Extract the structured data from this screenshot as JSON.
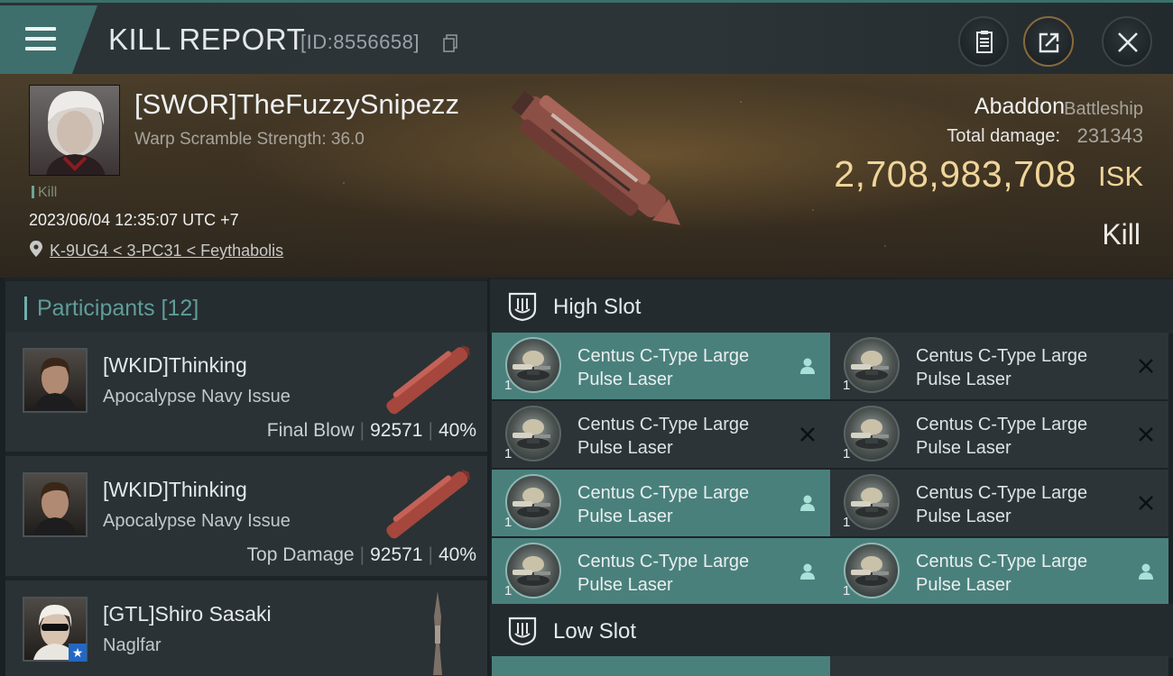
{
  "header": {
    "title": "KILL REPORT",
    "report_id": "[ID:8556658]"
  },
  "victim": {
    "name": "[SWOR]TheFuzzySnipezz",
    "subtitle": "Warp Scramble Strength: 36.0",
    "tag": "Kill",
    "datetime": "2023/06/04 12:35:07 UTC +7",
    "location": "K-9UG4 < 3-PC31 < Feythabolis",
    "ship_name": "Abaddon",
    "ship_class": "Battleship",
    "damage_label": "Total damage:",
    "damage_value": "231343",
    "isk_value": "2,708,983,708",
    "isk_unit": "ISK",
    "result": "Kill"
  },
  "participants": {
    "title": "Participants [12]",
    "items": [
      {
        "name": "[WKID]Thinking",
        "ship": "Apocalypse Navy Issue",
        "role": "Final Blow",
        "damage": "92571",
        "percent": "40%"
      },
      {
        "name": "[WKID]Thinking",
        "ship": "Apocalypse Navy Issue",
        "role": "Top Damage",
        "damage": "92571",
        "percent": "40%"
      },
      {
        "name": "[GTL]Shiro Sasaki",
        "ship": "Naglfar",
        "role": "",
        "damage": "",
        "percent": ""
      }
    ]
  },
  "slots": {
    "high_title": "High Slot",
    "low_title": "Low Slot",
    "high_modules": [
      {
        "line1": "Centus C-Type Large",
        "line2": "Pulse Laser",
        "qty": "1",
        "status": "fitted"
      },
      {
        "line1": "Centus C-Type Large",
        "line2": "Pulse Laser",
        "qty": "1",
        "status": "destroyed"
      },
      {
        "line1": "Centus C-Type Large",
        "line2": "Pulse Laser",
        "qty": "1",
        "status": "destroyed"
      },
      {
        "line1": "Centus C-Type Large",
        "line2": "Pulse Laser",
        "qty": "1",
        "status": "destroyed"
      },
      {
        "line1": "Centus C-Type Large",
        "line2": "Pulse Laser",
        "qty": "1",
        "status": "fitted"
      },
      {
        "line1": "Centus C-Type Large",
        "line2": "Pulse Laser",
        "qty": "1",
        "status": "destroyed"
      },
      {
        "line1": "Centus C-Type Large",
        "line2": "Pulse Laser",
        "qty": "1",
        "status": "fitted"
      },
      {
        "line1": "Centus C-Type Large",
        "line2": "Pulse Laser",
        "qty": "1",
        "status": "fitted"
      }
    ]
  },
  "icons": {
    "menu": "hamburger-menu-icon",
    "copy": "copy-icon",
    "clipboard": "clipboard-icon",
    "share": "share-icon",
    "close": "close-icon",
    "location": "map-pin-icon",
    "slot": "slot-shield-icon",
    "dropped": "person-icon",
    "destroyed": "x-icon"
  },
  "colors": {
    "accent": "#4a807c",
    "isk": "#efd59a",
    "panel": "#2c3438"
  }
}
